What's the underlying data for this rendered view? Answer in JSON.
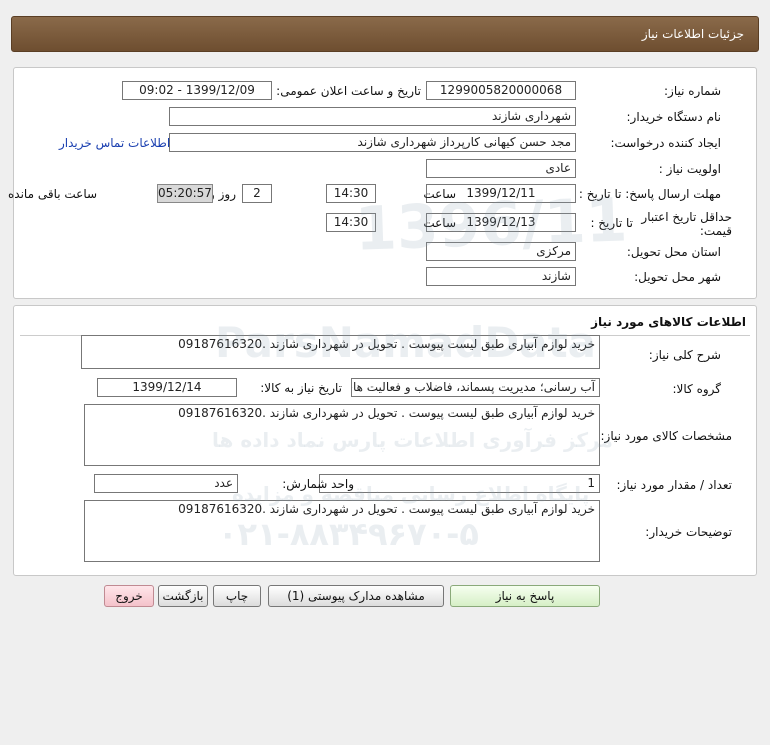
{
  "header": {
    "title": "جزئیات اطلاعات نیاز"
  },
  "info": {
    "need_number_label": "شماره نیاز:",
    "need_number": "1299005820000068",
    "announce_label": "تاریخ و ساعت اعلان عمومی:",
    "announce_value": "1399/12/09 - 09:02",
    "buyer_org_label": "نام دستگاه خریدار:",
    "buyer_org": "شهرداری شازند",
    "creator_label": "ایجاد کننده درخواست:",
    "creator": "مجد حسن کیهانی کارپرداز شهرداری شازند",
    "contact_link": "اطلاعات تماس خریدار",
    "priority_label": "اولویت نیاز :",
    "priority": "عادی",
    "deadline_label": "مهلت ارسال پاسخ: تا تاریخ :",
    "deadline_date": "1399/12/11",
    "time_label": "ساعت",
    "deadline_time": "14:30",
    "days": "2",
    "days_label": "روز و",
    "remaining": "05:20:57",
    "remaining_label": "ساعت باقی مانده",
    "validity_label": "حداقل تاریخ اعتبار قیمت:",
    "validity_to_label": "تا تاریخ :",
    "validity_date": "1399/12/13",
    "validity_time_label": "ساعت",
    "validity_time": "14:30",
    "province_label": "استان محل تحویل:",
    "province": "مرکزی",
    "city_label": "شهر محل تحویل:",
    "city": "شازند"
  },
  "goods": {
    "section_title": "اطلاعات کالاهای مورد نیاز",
    "desc_label": "شرح کلی نیاز:",
    "desc": "خرید لوازم آبیاری طبق لیست پیوست . تحویل در شهرداری شازند .09187616320",
    "group_label": "گروه کالا:",
    "group": "آب رسانی؛ مدیریت پسماند، فاضلاب و فعالیت های",
    "need_date_label": "تاریخ نیاز به کالا:",
    "need_date": "1399/12/14",
    "specs_label": "مشخصات کالای مورد نیاز:",
    "specs": "خرید لوازم آبیاری طبق لیست پیوست . تحویل در شهرداری شازند .09187616320",
    "qty_label": "تعداد / مقدار مورد نیاز:",
    "qty": "1",
    "unit_label": "واحد شمارش:",
    "unit": "عدد",
    "buyer_notes_label": "توضیحات خریدار:",
    "buyer_notes": "خرید لوازم آبیاری طبق لیست پیوست . تحویل در شهرداری شازند .09187616320"
  },
  "buttons": {
    "reply": "پاسخ به نیاز",
    "attachments": "مشاهده مدارک پیوستی (1)",
    "print": "چاپ",
    "back": "بازگشت",
    "exit": "خروج"
  },
  "watermark": {
    "line1": "ParsNamadData",
    "line2": "مرکز فرآوری اطلاعات پارس نماد داده ها",
    "line3": "پایگاه اطلاع رسانی مناقصه و مزایده",
    "line4": "۰۲۱-۸۸۳۴۹۶۷۰-۵",
    "number": "1396/11"
  }
}
